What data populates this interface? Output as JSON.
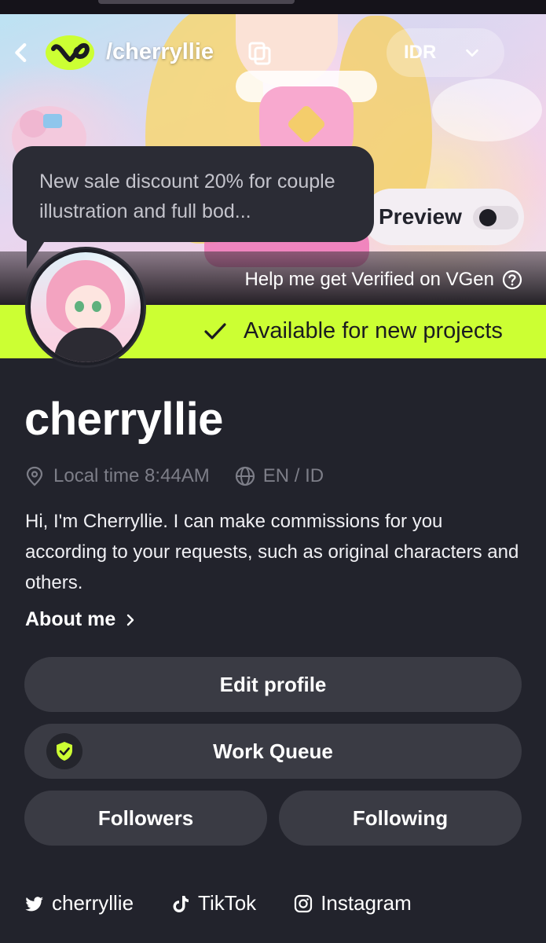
{
  "header": {
    "back_label": "‹",
    "handle": "/cherryllie",
    "currency": "IDR"
  },
  "banner": {
    "promo_text": "New sale discount 20% for couple illustration and full bod...",
    "preview_label": "Preview",
    "verify_link": "Help me get Verified on VGen"
  },
  "status": {
    "availability": "Available for new projects",
    "accent_color": "#ccff33"
  },
  "profile": {
    "username": "cherryllie",
    "local_time": "Local time 8:44AM",
    "languages": "EN / ID",
    "bio": "Hi, I'm Cherryllie. I can make commissions for you according to your requests, such as original characters and others.",
    "about_label": "About me"
  },
  "actions": {
    "edit_profile": "Edit profile",
    "work_queue": "Work Queue",
    "followers": "Followers",
    "following": "Following"
  },
  "socials": [
    {
      "icon": "twitter-icon",
      "label": "cherryllie"
    },
    {
      "icon": "tiktok-icon",
      "label": "TikTok"
    },
    {
      "icon": "instagram-icon",
      "label": "Instagram"
    }
  ]
}
